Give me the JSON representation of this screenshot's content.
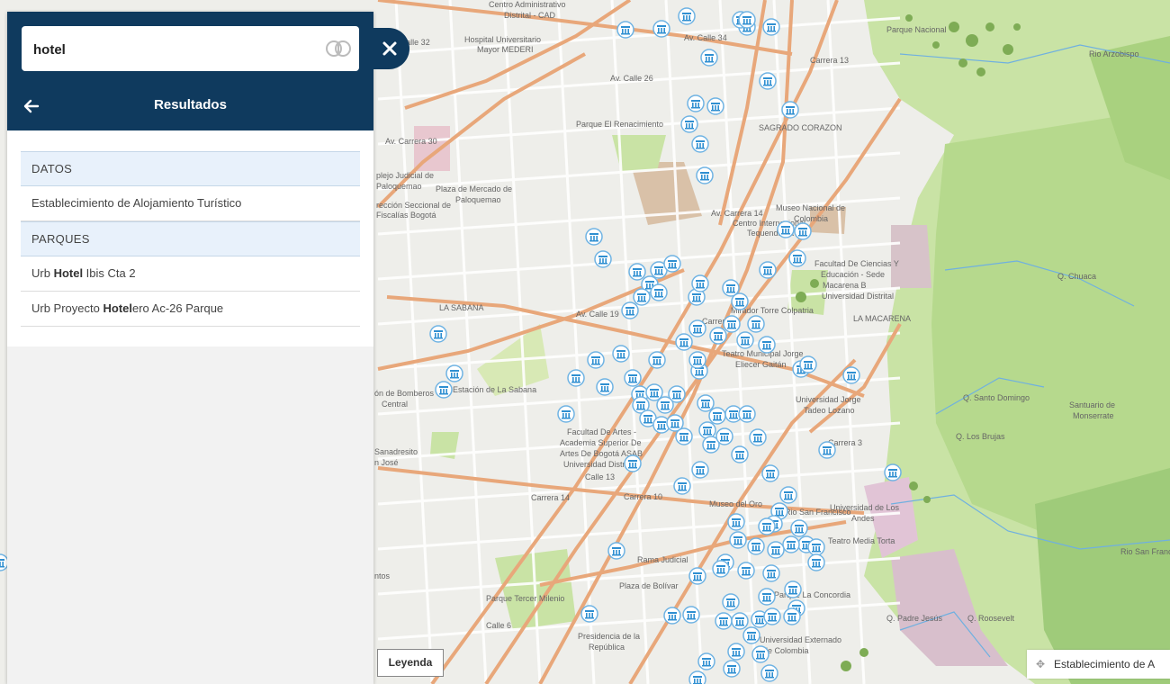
{
  "search": {
    "value": "hotel"
  },
  "header": {
    "title": "Resultados"
  },
  "results": {
    "sections": [
      {
        "label": "DATOS",
        "items": [
          {
            "parts": [
              {
                "t": "Establecimiento de Alojamiento Turístico",
                "b": false
              }
            ]
          }
        ]
      },
      {
        "label": "PARQUES",
        "items": [
          {
            "parts": [
              {
                "t": "Urb ",
                "b": false
              },
              {
                "t": "Hotel",
                "b": true
              },
              {
                "t": " Ibis Cta 2",
                "b": false
              }
            ]
          },
          {
            "parts": [
              {
                "t": "Urb Proyecto ",
                "b": false
              },
              {
                "t": "Hotel",
                "b": true
              },
              {
                "t": "ero Ac-26 Parque",
                "b": false
              }
            ]
          }
        ]
      }
    ]
  },
  "legend_button": "Leyenda",
  "layer_tag": "Establecimiento de A",
  "map": {
    "colors": {
      "base": "#eeeeea",
      "park": "#c9e3a5",
      "hill": "#b4d88f",
      "road": "#e8b38e",
      "major_road": "#e39d6d",
      "pin": "#2f8fd1"
    },
    "labels": [
      "Centro Administrativo",
      "Distrital - CAD",
      "Hospital Universitario",
      "Mayor MEDERI",
      "Av. Calle 34",
      "Parque Nacional",
      "Rio Arzobispo",
      "Parque El Renacimiento",
      "SAGRADO CORAZON",
      "plejo Judicial de",
      "Paloquemao",
      "Plaza de Mercado de",
      "Paloquemao",
      "rección Seccional de",
      "Fiscalías Bogotá",
      "Museo Nacional de",
      "Colombia",
      "Centro Internacional",
      "Tequendama",
      "Facultad De Ciencias Y",
      "Educación - Sede",
      "Macarena B",
      "Universidad Distrital",
      "Q. Chuaca",
      "LA SABANA",
      "Av. Calle 19",
      "Mirador Torre Colpatria",
      "LA MACARENA",
      "Teatro Municipal Jorge",
      "Eliecer Gaitán",
      "Q. Santo Domingo",
      "ón de Bomberos",
      "Central",
      "Estación de La Sabana",
      "Universidad Jorge",
      "Tadeo Lozano",
      "Santuario de",
      "Monserrate",
      "Q. Los Brujas",
      "Facultad De Artes -",
      "Academia Superior De",
      "Artes De Bogotá ASAB",
      "Universidad Distri",
      "Sanadresito",
      "n José",
      "Calle 13",
      "Carrera 14",
      "Carrera 10",
      "Museo del Oro",
      "Rio San Francisco",
      "Universidad de Los",
      "Andes",
      "Teatro Media Torta",
      "Rio San Franc",
      "Rama Judicial",
      "Plaza de Bolívar",
      "Parque Tercer Milenio",
      "Parque La Concordia",
      "Q. Padre Jesús",
      "Q. Roosevelt",
      "Presidencia de la",
      "República",
      "Universidad Externado",
      "de Colombia",
      "Calle 6",
      "Av. Calle 26",
      "Av. Carrera 30",
      "Carrera 13",
      "Av. Carrera 14",
      "Carrera 7",
      "Carrera 3",
      "ntos",
      "Av. Calle 32"
    ]
  }
}
